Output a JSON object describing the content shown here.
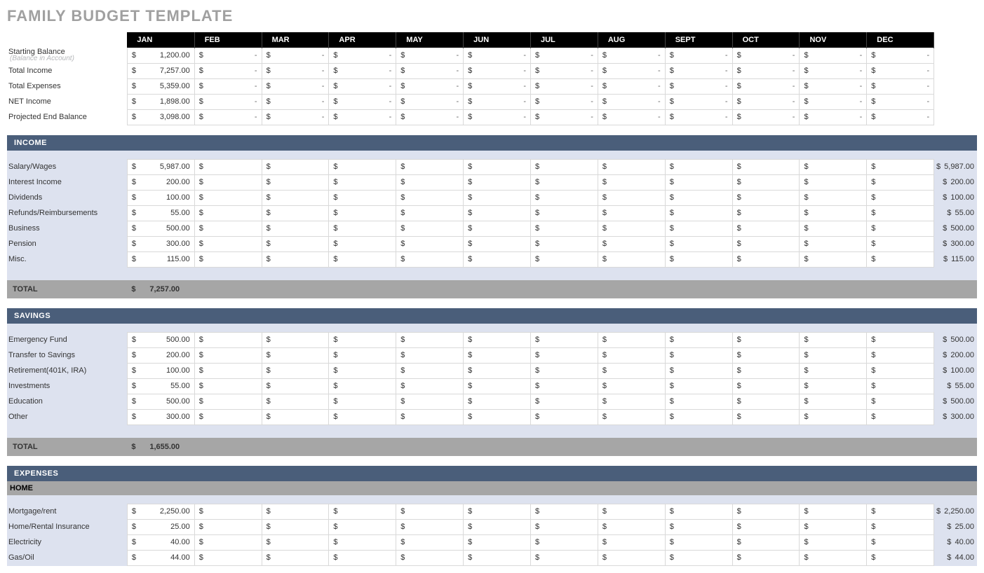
{
  "title": "FAMILY BUDGET TEMPLATE",
  "months": [
    "JAN",
    "FEB",
    "MAR",
    "APR",
    "MAY",
    "JUN",
    "JUL",
    "AUG",
    "SEPT",
    "OCT",
    "NOV",
    "DEC"
  ],
  "summary": {
    "rows": [
      {
        "label": "Starting Balance",
        "sublabel": "(Balance in Account)",
        "jan": "1,200.00"
      },
      {
        "label": "Total Income",
        "jan": "7,257.00"
      },
      {
        "label": "Total Expenses",
        "jan": "5,359.00"
      },
      {
        "label": "NET Income",
        "jan": "1,898.00"
      },
      {
        "label": "Projected End Balance",
        "jan": "3,098.00"
      }
    ]
  },
  "sections": [
    {
      "name": "INCOME",
      "rows": [
        {
          "label": "Salary/Wages",
          "jan": "5,987.00",
          "total": "5,987.00"
        },
        {
          "label": "Interest Income",
          "jan": "200.00",
          "total": "200.00"
        },
        {
          "label": "Dividends",
          "jan": "100.00",
          "total": "100.00"
        },
        {
          "label": "Refunds/Reimbursements",
          "jan": "55.00",
          "total": "55.00"
        },
        {
          "label": "Business",
          "jan": "500.00",
          "total": "500.00"
        },
        {
          "label": "Pension",
          "jan": "300.00",
          "total": "300.00"
        },
        {
          "label": "Misc.",
          "jan": "115.00",
          "total": "115.00"
        }
      ],
      "total_label": "TOTAL",
      "total_jan": "7,257.00"
    },
    {
      "name": "SAVINGS",
      "rows": [
        {
          "label": "Emergency Fund",
          "jan": "500.00",
          "total": "500.00"
        },
        {
          "label": "Transfer to Savings",
          "jan": "200.00",
          "total": "200.00"
        },
        {
          "label": "Retirement(401K, IRA)",
          "jan": "100.00",
          "total": "100.00"
        },
        {
          "label": "Investments",
          "jan": "55.00",
          "total": "55.00"
        },
        {
          "label": "Education",
          "jan": "500.00",
          "total": "500.00"
        },
        {
          "label": "Other",
          "jan": "300.00",
          "total": "300.00"
        }
      ],
      "total_label": "TOTAL",
      "total_jan": "1,655.00"
    },
    {
      "name": "EXPENSES",
      "sub": "HOME",
      "rows": [
        {
          "label": "Mortgage/rent",
          "jan": "2,250.00",
          "total": "2,250.00"
        },
        {
          "label": "Home/Rental Insurance",
          "jan": "25.00",
          "total": "25.00"
        },
        {
          "label": "Electricity",
          "jan": "40.00",
          "total": "40.00"
        },
        {
          "label": "Gas/Oil",
          "jan": "44.00",
          "total": "44.00"
        }
      ]
    }
  ]
}
